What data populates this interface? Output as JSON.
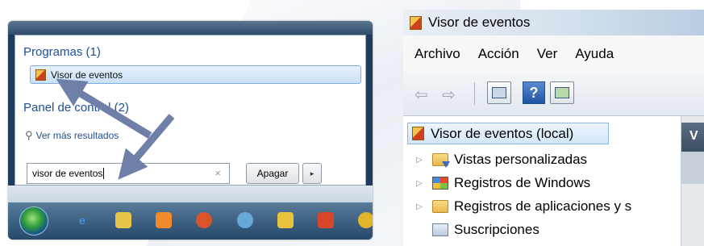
{
  "start_menu": {
    "section_programs": "Programas (1)",
    "result_item": "Visor de eventos",
    "section_panel": "Panel de control (2)",
    "more_results": "Ver más resultados",
    "search_value": "visor de eventos",
    "shutdown_label": "Apagar",
    "shutdown_arrow": "▸",
    "clear_icon": "×",
    "taskbar_icons": [
      "ie-icon",
      "explorer-icon",
      "media-player-icon",
      "firefox-icon",
      "network-icon",
      "paint-icon",
      "java-icon",
      "chrome-icon"
    ]
  },
  "event_viewer": {
    "title": "Visor de eventos",
    "menu": [
      "Archivo",
      "Acción",
      "Ver",
      "Ayuda"
    ],
    "help_icon_label": "?",
    "tree": {
      "root": "Visor de eventos (local)",
      "items": [
        "Vistas personalizadas",
        "Registros de Windows",
        "Registros de aplicaciones y s",
        "Suscripciones"
      ]
    },
    "side_header": "V"
  },
  "colors": {
    "link_blue": "#1e4f96",
    "arrow": "#6e7fa8",
    "taskbar": "#26486a"
  }
}
